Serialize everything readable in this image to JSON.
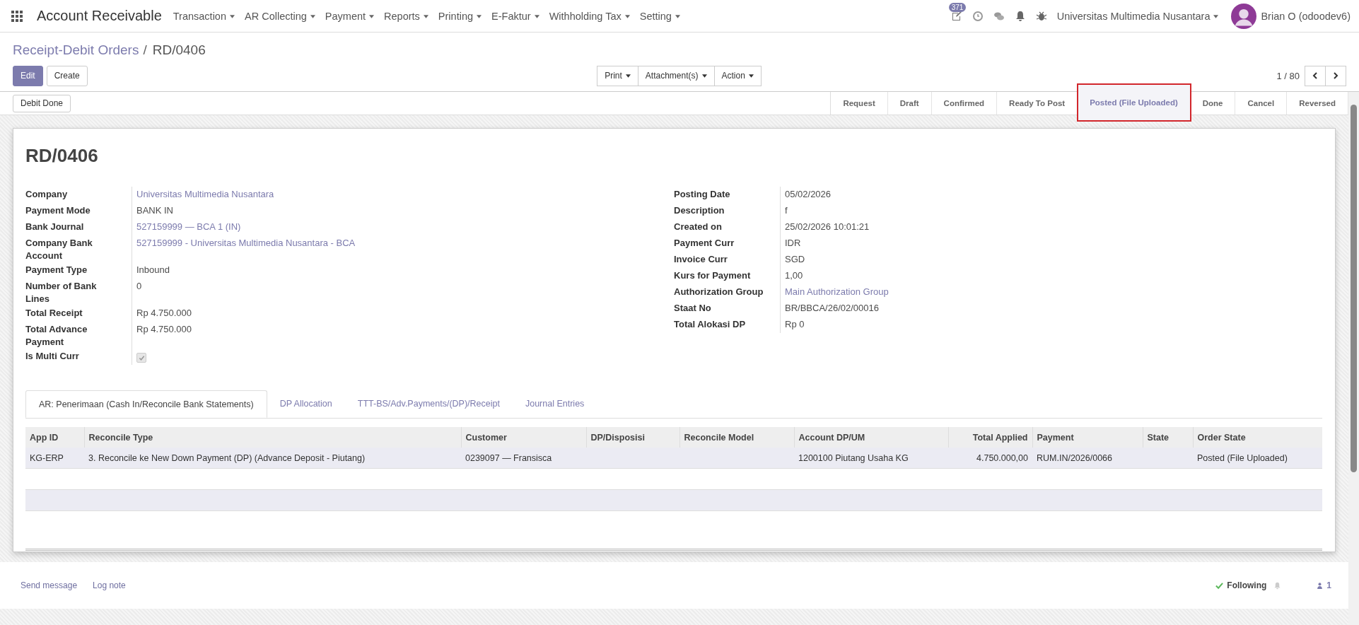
{
  "app": {
    "title": "Account Receivable",
    "menus": [
      "Transaction",
      "AR Collecting",
      "Payment",
      "Reports",
      "Printing",
      "E-Faktur",
      "Withholding Tax",
      "Setting"
    ],
    "notification_count": "371",
    "company": "Universitas Multimedia Nusantara",
    "user": "Brian O (odoodev6)"
  },
  "breadcrumb_separator": "/",
  "breadcrumb": [
    {
      "label": "Receipt-Debit Orders",
      "kind": "link"
    },
    {
      "label": "RD/0406",
      "kind": "current"
    }
  ],
  "buttons": {
    "edit": "Edit",
    "create": "Create",
    "center": [
      "Print",
      "Attachment(s)",
      "Action"
    ],
    "pager": "1 / 80"
  },
  "header_button": "Debit Done",
  "stages": [
    {
      "label": "Request",
      "selected": false,
      "highlighted": false
    },
    {
      "label": "Draft",
      "selected": false,
      "highlighted": false
    },
    {
      "label": "Confirmed",
      "selected": false,
      "highlighted": false
    },
    {
      "label": "Ready To Post",
      "selected": false,
      "highlighted": false
    },
    {
      "label": "Posted (File Uploaded)",
      "selected": true,
      "highlighted": true
    },
    {
      "label": "Done",
      "selected": false,
      "highlighted": false
    },
    {
      "label": "Cancel",
      "selected": false,
      "highlighted": false
    },
    {
      "label": "Reversed",
      "selected": false,
      "highlighted": false
    }
  ],
  "form": {
    "title": "RD/0406",
    "left": [
      {
        "label": "Company",
        "value": "Universitas Multimedia Nusantara",
        "kind": "link"
      },
      {
        "label": "Payment Mode",
        "value": "BANK IN",
        "kind": "text"
      },
      {
        "label": "Bank Journal",
        "value": "527159999 — BCA 1 (IN)",
        "kind": "link"
      },
      {
        "label": "Company Bank Account",
        "value": "527159999 - Universitas Multimedia Nusantara - BCA",
        "kind": "link"
      },
      {
        "label": "Payment Type",
        "value": "Inbound",
        "kind": "text"
      },
      {
        "label": "Number of Bank Lines",
        "value": "0",
        "kind": "text"
      },
      {
        "label": "Total Receipt",
        "value": "Rp 4.750.000",
        "kind": "text"
      },
      {
        "label": "Total Advance Payment",
        "value": "Rp 4.750.000",
        "kind": "text"
      },
      {
        "label": "Is Multi Curr",
        "kind": "checkbox",
        "checked": true
      }
    ],
    "right": [
      {
        "label": "Posting Date",
        "value": "05/02/2026",
        "kind": "text"
      },
      {
        "label": "Description",
        "value": "f",
        "kind": "text"
      },
      {
        "label": "Created on",
        "value": "25/02/2026 10:01:21",
        "kind": "text"
      },
      {
        "label": "Payment Curr",
        "value": "IDR",
        "kind": "text"
      },
      {
        "label": "Invoice Curr",
        "value": "SGD",
        "kind": "text"
      },
      {
        "label": "Kurs for Payment",
        "value": "1,00",
        "kind": "text"
      },
      {
        "label": "Authorization Group",
        "value": "Main Authorization Group",
        "kind": "link"
      },
      {
        "label": "Staat No",
        "value": "BR/BBCA/26/02/00016",
        "kind": "text"
      },
      {
        "label": "Total Alokasi DP",
        "value": "Rp 0",
        "kind": "text"
      }
    ]
  },
  "tabs": [
    {
      "label": "AR: Penerimaan (Cash In/Reconcile Bank Statements)",
      "selected": true
    },
    {
      "label": "DP Allocation",
      "selected": false
    },
    {
      "label": "TTT-BS/Adv.Payments/(DP)/Receipt",
      "selected": false
    },
    {
      "label": "Journal Entries",
      "selected": false
    }
  ],
  "table": {
    "columns": [
      "App ID",
      "Reconcile Type",
      "Customer",
      "DP/Disposisi",
      "Reconcile Model",
      "Account DP/UM",
      "Total Applied",
      "Payment",
      "State",
      "Order State"
    ],
    "rows": [
      {
        "cells": [
          "KG-ERP",
          "3. Reconcile ke New Down Payment (DP) (Advance Deposit - Piutang)",
          "0239097 — Fransisca",
          "",
          "",
          "1200100 Piutang Usaha KG",
          "4.750.000,00",
          "RUM.IN/2026/0066",
          "",
          "Posted (File Uploaded)"
        ]
      }
    ]
  },
  "chatter": {
    "send_message": "Send message",
    "log_note": "Log note",
    "following": "Following",
    "followers": "1"
  }
}
